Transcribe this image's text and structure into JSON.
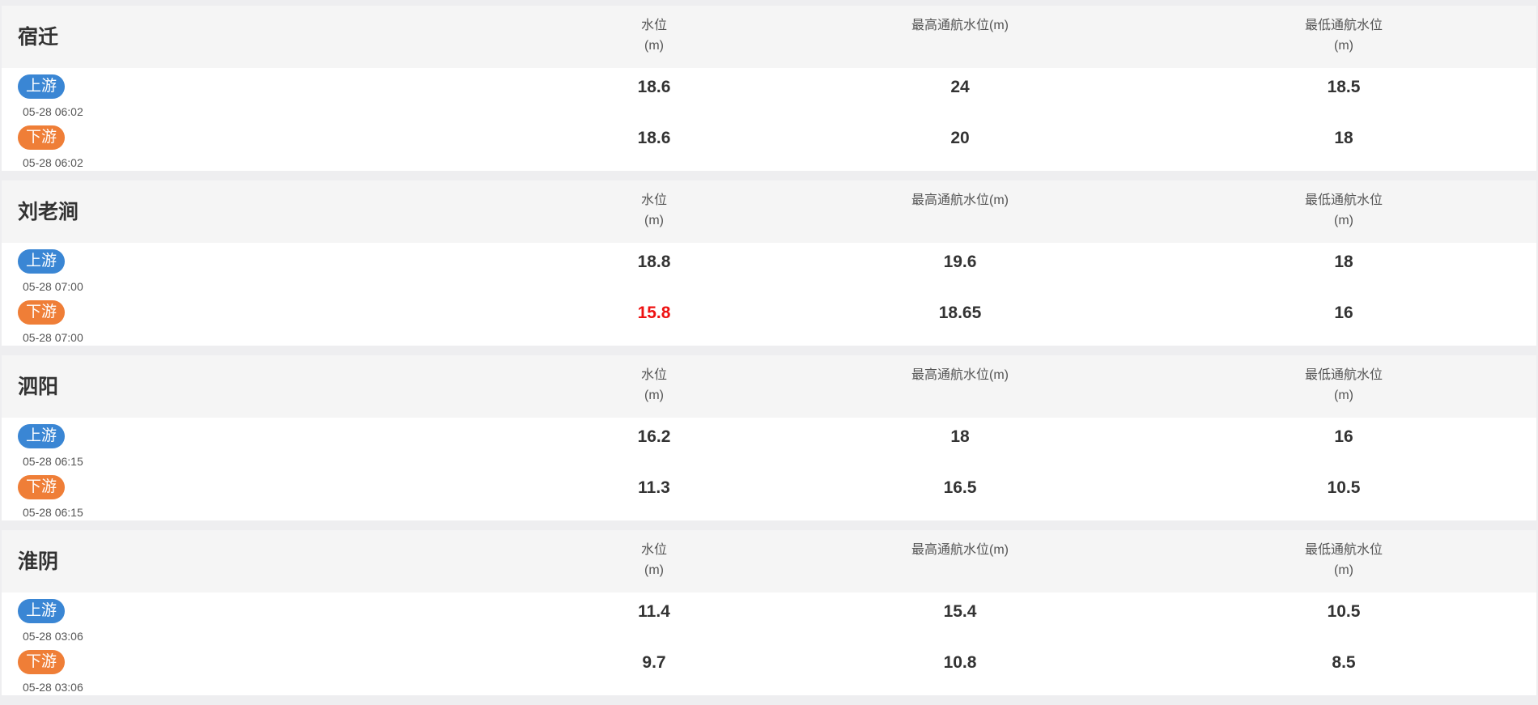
{
  "colors": {
    "upstream_badge": "#3a86d4",
    "downstream_badge": "#ef7e37",
    "alert_value": "#ee1111",
    "header_background": "#f5f5f5",
    "page_background": "#eeeef0"
  },
  "column_headers": {
    "level_line1": "水位",
    "level_line2": "(m)",
    "max_nav": "最高通航水位(m)",
    "min_nav_line1": "最低通航水位",
    "min_nav_line2": "(m)"
  },
  "stations": [
    {
      "name": "宿迁",
      "upstream": {
        "label": "上游",
        "time": "05-28 06:02",
        "level": "18.6",
        "max_nav": "24",
        "min_nav": "18.5",
        "alert": false
      },
      "downstream": {
        "label": "下游",
        "time": "05-28 06:02",
        "level": "18.6",
        "max_nav": "20",
        "min_nav": "18",
        "alert": false
      }
    },
    {
      "name": "刘老涧",
      "upstream": {
        "label": "上游",
        "time": "05-28 07:00",
        "level": "18.8",
        "max_nav": "19.6",
        "min_nav": "18",
        "alert": false
      },
      "downstream": {
        "label": "下游",
        "time": "05-28 07:00",
        "level": "15.8",
        "max_nav": "18.65",
        "min_nav": "16",
        "alert": true
      }
    },
    {
      "name": "泗阳",
      "upstream": {
        "label": "上游",
        "time": "05-28 06:15",
        "level": "16.2",
        "max_nav": "18",
        "min_nav": "16",
        "alert": false
      },
      "downstream": {
        "label": "下游",
        "time": "05-28 06:15",
        "level": "11.3",
        "max_nav": "16.5",
        "min_nav": "10.5",
        "alert": false
      }
    },
    {
      "name": "淮阴",
      "upstream": {
        "label": "上游",
        "time": "05-28 03:06",
        "level": "11.4",
        "max_nav": "15.4",
        "min_nav": "10.5",
        "alert": false
      },
      "downstream": {
        "label": "下游",
        "time": "05-28 03:06",
        "level": "9.7",
        "max_nav": "10.8",
        "min_nav": "8.5",
        "alert": false
      }
    }
  ]
}
